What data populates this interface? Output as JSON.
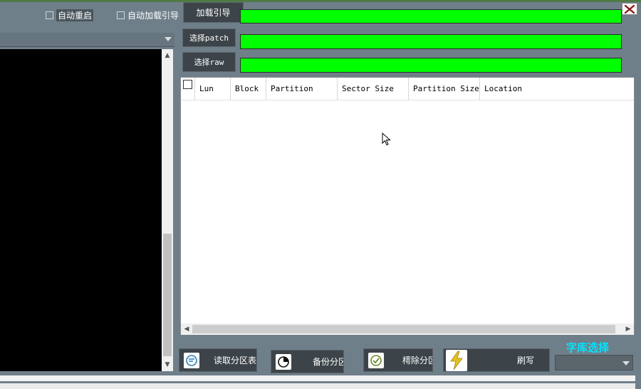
{
  "options": {
    "auto_reboot": "自动重启",
    "auto_load_loader": "自动加载引导"
  },
  "buttons": {
    "load_loader": "加载引导",
    "select_patch": "选择patch",
    "select_raw": "选择raw"
  },
  "table": {
    "columns": [
      "Lun",
      "Block",
      "Partition",
      "Sector Size",
      "Partition Size",
      "Location"
    ]
  },
  "actions": {
    "read_partitions": "读取分区表",
    "backup_partitions": "备份分区",
    "erase_partitions": "樗除分区",
    "flash": "刷写"
  },
  "font_library": {
    "label": "字库选择",
    "selected": ""
  },
  "colors": {
    "progress": "#00ff00",
    "accent_label": "#00e5ff"
  },
  "icons": [
    "close-icon",
    "read-icon",
    "backup-icon",
    "check-icon",
    "lightning-icon"
  ]
}
